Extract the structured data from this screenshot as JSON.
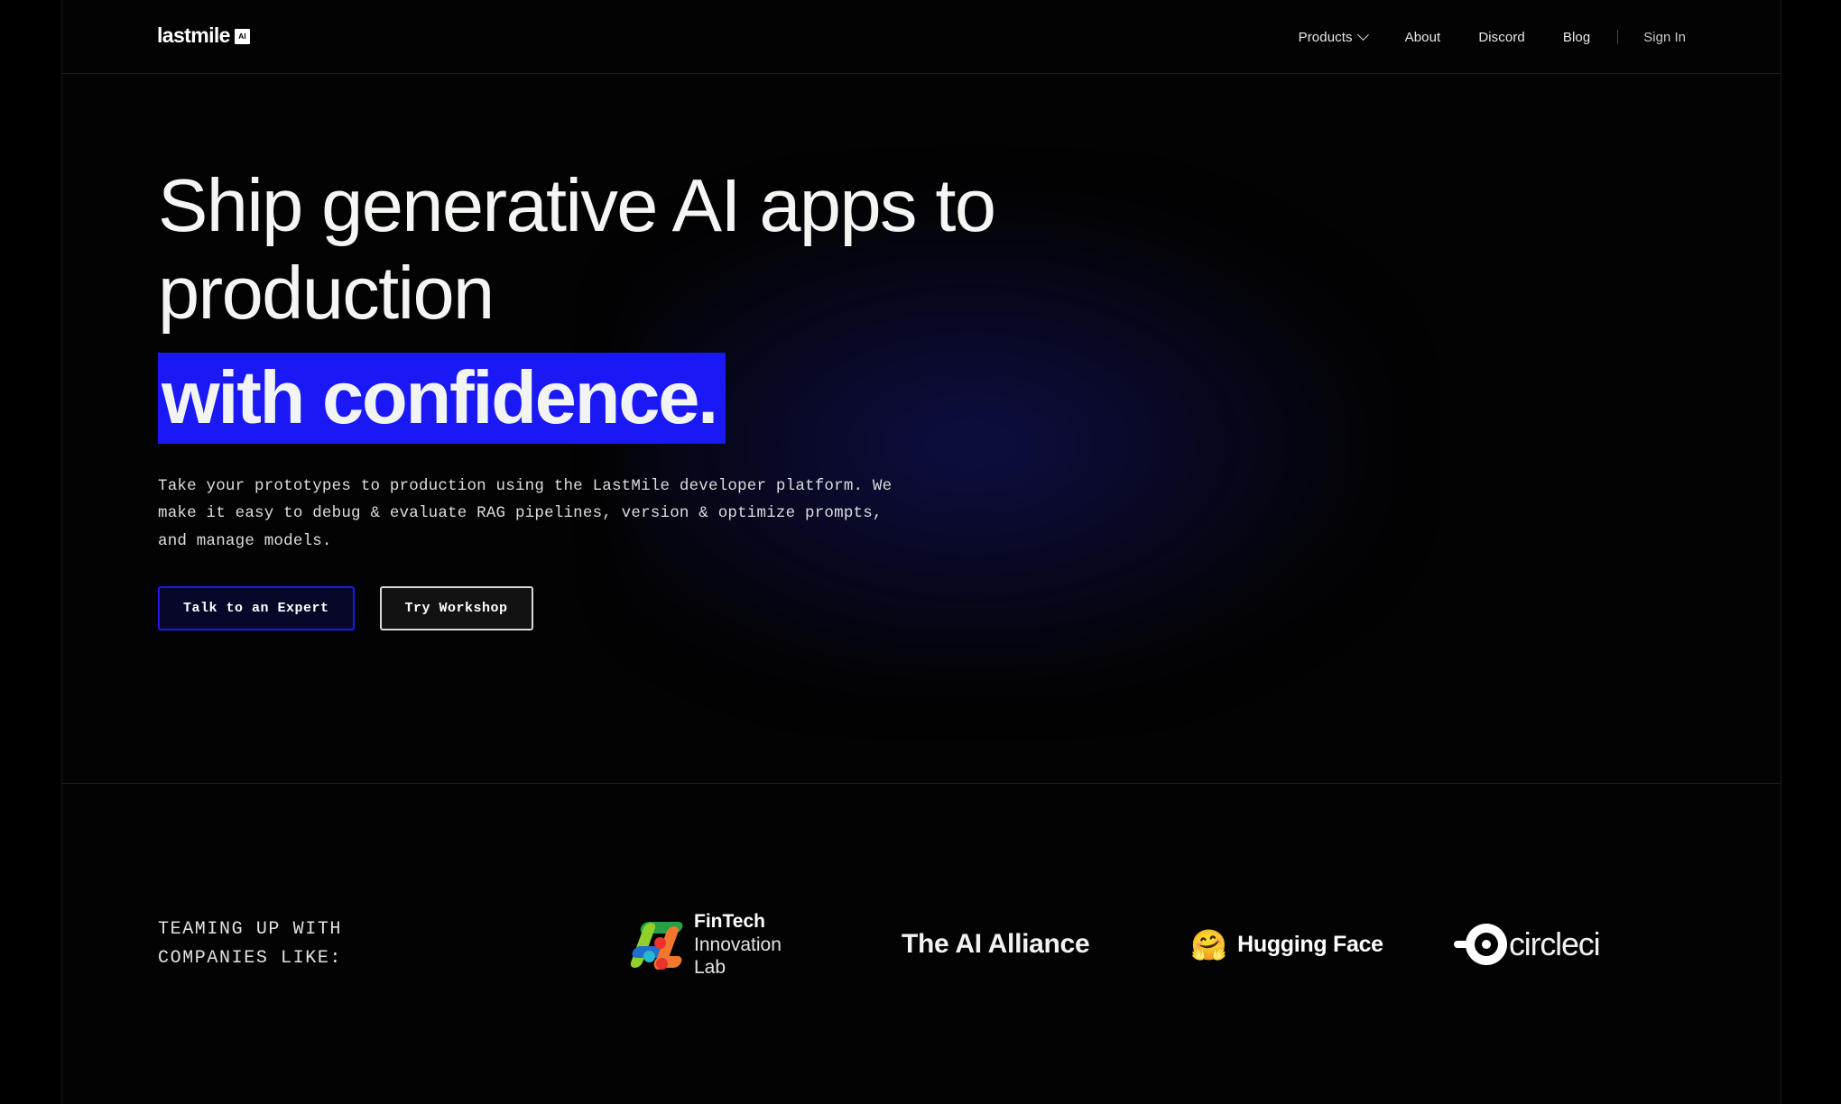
{
  "header": {
    "logo": {
      "word": "lastmile",
      "badge": "AI"
    },
    "nav": [
      {
        "label": "Products",
        "icon": "chevron-down-icon",
        "has_chevron": true
      },
      {
        "label": "About",
        "has_chevron": false
      },
      {
        "label": "Discord",
        "has_chevron": false
      },
      {
        "label": "Blog",
        "has_chevron": false
      }
    ],
    "sign_in": "Sign In"
  },
  "hero": {
    "headline_line1": "Ship generative AI apps to",
    "headline_line2": "production",
    "headline_highlight": "with confidence.",
    "highlight_color": "#1a18f5",
    "subtext": "Take your prototypes to production using the LastMile developer platform. We make it easy to debug & evaluate RAG pipelines, version & optimize prompts, and manage models.",
    "buttons": {
      "primary": "Talk to an Expert",
      "secondary": "Try Workshop"
    }
  },
  "partners": {
    "label_line1": "TEAMING UP WITH",
    "label_line2": "COMPANIES LIKE:",
    "logos": [
      {
        "name": "fintech-innovation-lab",
        "text1": "FinTech",
        "text2": "Innovation",
        "text3": "Lab"
      },
      {
        "name": "the-ai-alliance",
        "text": "The AI Alliance"
      },
      {
        "name": "hugging-face",
        "emoji": "🤗",
        "text": "Hugging Face"
      },
      {
        "name": "circleci",
        "text": "circleci"
      }
    ]
  }
}
